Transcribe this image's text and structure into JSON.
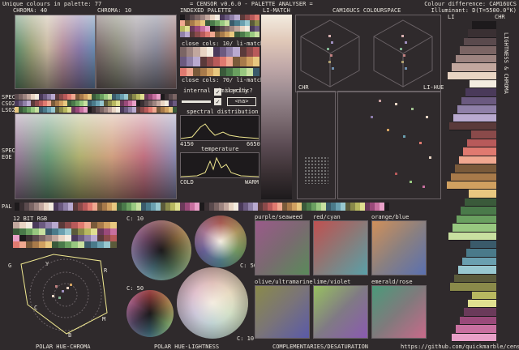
{
  "header": {
    "unique_colours": "Unique colours in palette: 77",
    "title": "= CENSOR v0.6.0 - PALETTE ANALYSER =",
    "colour_difference": "Colour difference: CAM16UCS",
    "illuminant": "Illuminant: D(T=5500.0°K)"
  },
  "panels": {
    "chroma40": "CHROMA: 40",
    "chroma10": "CHROMA: 10",
    "indexed_palette": "INDEXED PALETTE",
    "li_match": "LI-MATCH",
    "cam16ucs": "CAM16UCS COLOURSPACE",
    "li": "LI",
    "chr_top": "CHR",
    "side_text": "LIGHTNESS & CHROMA",
    "close_cols_1": "close cols: 10/ li-match",
    "close_cols_2": "close cols: 70/ li-match",
    "internal_similarity": "internal similarity",
    "scyclic": "scyclic?",
    "na": "<na>",
    "spectral_distribution": "spectral distribution",
    "spec_min": "4150",
    "spec_max": "6650",
    "temperature": "temperature",
    "cold": "COLD",
    "warm": "WARM",
    "chr": "CHR",
    "li_hue": "LI-HUE",
    "spec1": "SPEC",
    "cso2": "CSO2",
    "lso2": "LSO2",
    "spec2": "SPEC",
    "eoe": "EOE",
    "pal": "PAL",
    "bit12": "12 BIT RGB",
    "c10a": "C: 10",
    "c50a": "C: 50",
    "c50b": "C: 50",
    "c10b": "C: 10",
    "purple_seaweed": "purple/seaweed",
    "red_cyan": "red/cyan",
    "orange_blue": "orange/blue",
    "olive_ultramarine": "olive/ultramarine",
    "lime_violet": "lime/violet",
    "emerald_rose": "emerald/rose",
    "polar_hue_chroma": "POLAR HUE-CHROMA",
    "polar_hue_lightness": "POLAR HUE-LIGHTNESS",
    "complementaries": "COMPLEMENTARIES/DESATURATION",
    "url": "https://github.com/quickmarble/censor",
    "hex_g": "G",
    "hex_y": "Y",
    "hex_r": "R",
    "hex_m": "M",
    "hex_b": "B",
    "hex_c": "C"
  },
  "colors": {
    "bg": "#2f2a2c",
    "dark": "#1d1a1c",
    "text": "#e8e4dc",
    "accent_yellow": "#f0e890"
  },
  "palette": [
    "#1d1a1c",
    "#3a3033",
    "#5a4a4d",
    "#7b6564",
    "#9d8480",
    "#c2a79e",
    "#e8d4c3",
    "#f3ece0",
    "#4a3a5a",
    "#6b5a80",
    "#8f80a8",
    "#b9aad0",
    "#5a3a3a",
    "#8a4a4a",
    "#b85a5a",
    "#e07a70",
    "#f0a890",
    "#7a5a3a",
    "#a87a4a",
    "#d0a060",
    "#e8c880",
    "#3a5a3a",
    "#4a7a4a",
    "#6aa060",
    "#98c880",
    "#c8e0a0",
    "#3a5a6a",
    "#4a7a8a",
    "#6aa0b0",
    "#98c8d0",
    "#5a5a3a",
    "#8a8a4a",
    "#b8b860",
    "#e0e090",
    "#6a3a5a",
    "#9a4a7a",
    "#c870a0",
    "#e8a0c8"
  ]
}
